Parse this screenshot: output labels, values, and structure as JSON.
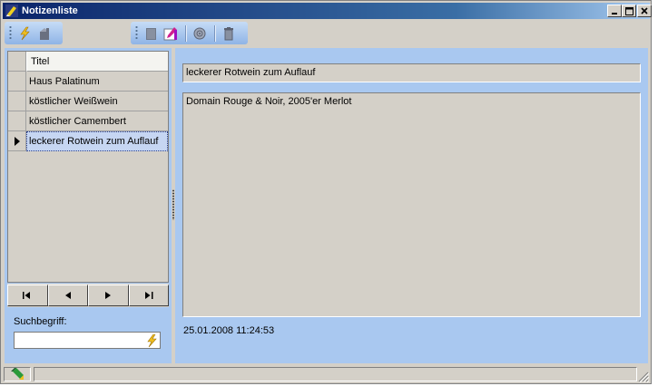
{
  "window": {
    "title": "Notizenliste"
  },
  "toolbar": {
    "icons": [
      "lightning-icon",
      "stack-icon",
      "note-icon",
      "edit-pencil-icon",
      "pin-icon",
      "trash-icon"
    ]
  },
  "grid": {
    "header": "Titel",
    "rows": [
      {
        "title": "Haus Palatinum"
      },
      {
        "title": "köstlicher Weißwein"
      },
      {
        "title": "köstlicher Camembert"
      },
      {
        "title": "leckerer Rotwein zum Auflauf"
      }
    ],
    "selected_index": 3
  },
  "search": {
    "label": "Suchbegriff:",
    "value": ""
  },
  "detail": {
    "title": "leckerer Rotwein zum Auflauf",
    "body": "Domain Rouge & Noir, 2005'er Merlot",
    "timestamp": "25.01.2008 11:24:53"
  },
  "statusbar": {
    "text": ""
  },
  "colors": {
    "titlebar": "#0a246a",
    "panel": "#a9c8f0",
    "toolbar": "#c6dcf6",
    "selection": "#c6d6f2"
  }
}
